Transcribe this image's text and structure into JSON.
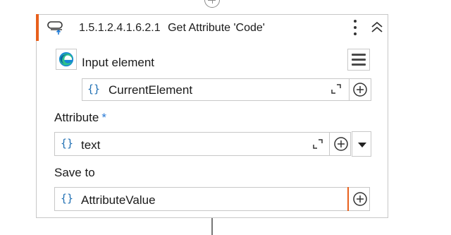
{
  "activity": {
    "number": "1.5.1.2.4.1.6.2.1",
    "title": "Get Attribute 'Code'",
    "accent_color": "#e8601c"
  },
  "input_element": {
    "label": "Input element",
    "value": "CurrentElement",
    "brace": "{}"
  },
  "attribute": {
    "label": "Attribute",
    "required_mark": "*",
    "value": "text",
    "brace": "{}"
  },
  "save_to": {
    "label": "Save to",
    "value": "AttributeValue",
    "brace": "{}"
  },
  "icons": [
    "add-activity-icon",
    "get-attribute-icon",
    "more-options-icon",
    "collapse-icon",
    "edge-browser-icon",
    "menu-icon",
    "expand-editor-icon",
    "plus-circle-icon",
    "dropdown-arrow-icon"
  ]
}
